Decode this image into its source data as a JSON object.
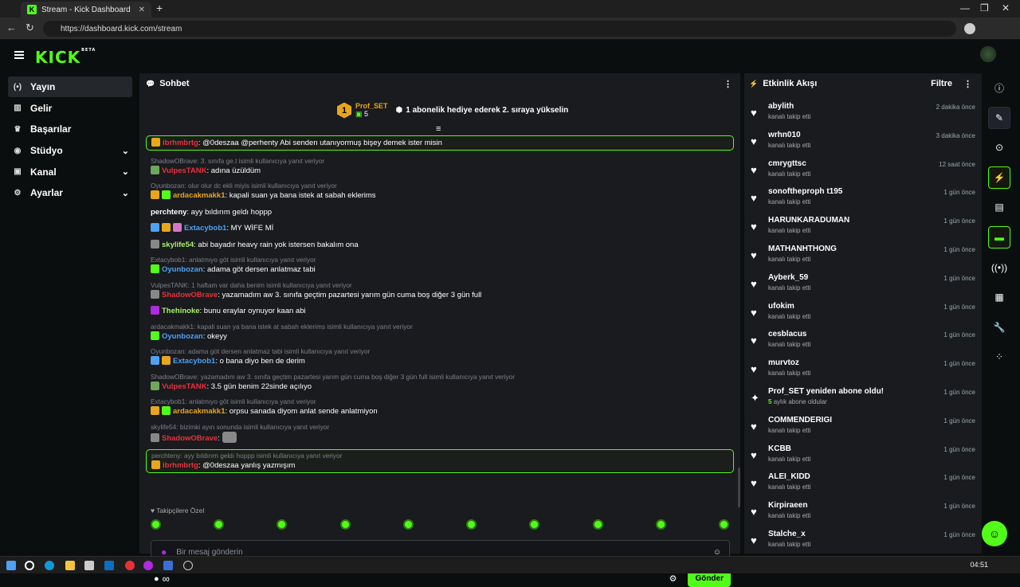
{
  "browser": {
    "tab_title": "Stream - Kick Dashboard",
    "url": "https://dashboard.kick.com/stream"
  },
  "header": {
    "logo": "KICK",
    "logo_badge": "BETA"
  },
  "sidebar": {
    "items": [
      {
        "label": "Yayın",
        "icon": "broadcast-icon",
        "active": true
      },
      {
        "label": "Gelir",
        "icon": "revenue-icon"
      },
      {
        "label": "Başarılar",
        "icon": "trophy-icon"
      },
      {
        "label": "Stüdyo",
        "icon": "studio-icon",
        "expandable": true
      },
      {
        "label": "Kanal",
        "icon": "channel-icon",
        "expandable": true
      },
      {
        "label": "Ayarlar",
        "icon": "settings-icon",
        "expandable": true
      }
    ]
  },
  "chat": {
    "title": "Sohbet",
    "pinned": {
      "rank": "1",
      "user": "Prof_SET",
      "gifts": "5",
      "text": "1 abonelik hediye ederek 2. sıraya yükselin"
    },
    "messages": [
      {
        "user": "ibrhmbrtg",
        "color": "#e8313d",
        "text": ": @0deszaa @perhenty Abi senden utanıyormuş bişey demek ister misin",
        "highlight": true,
        "badges": [
          "#e9a61b"
        ]
      },
      {
        "reply": "ShadowOBrave: 3. sınıfa ge.t isimli kullanıcıya yanıt veriyor",
        "user": "VulpesTANK",
        "color": "#e8313d",
        "text": ": adına üzüldüm",
        "badges": [
          "#6ea85f"
        ]
      },
      {
        "reply": "Oyunbozan: olur olur dc ekli miyis isimli kullanıcıya yanıt veriyor",
        "user": "ardacakmakk1",
        "color": "#e9a61b",
        "text": ": kapali suan ya bana istek at sabah eklerims",
        "badges": [
          "#e9a61b",
          "#53fc18"
        ]
      },
      {
        "user": "perchteny",
        "color": "#ffffff",
        "text": ": ayy bıldırım geldı hoppp",
        "badges": []
      },
      {
        "user": "Extacybob1",
        "color": "#4ea1f3",
        "text": ": MY WİFE Mİ",
        "badges": [
          "#4ea1f3",
          "#e9a61b",
          "#d577c9"
        ]
      },
      {
        "user": "skylife54",
        "color": "#a7f06a",
        "text": ": abi bayadır heavy rain yok istersen bakalım ona",
        "badges": [
          "#888888"
        ]
      },
      {
        "reply": "Extacybob1: anlatmıyo göt isimli kullanıcıya yanıt veriyor",
        "user": "Oyunbozan",
        "color": "#4ea1f3",
        "text": ": adama göt dersen anlatmaz tabi",
        "badges": [
          "#53fc18"
        ]
      },
      {
        "reply": "VulpesTANK: 1 haftam var daha benim isimli kullanıcıya yanıt veriyor",
        "user": "ShadowOBrave",
        "color": "#e8313d",
        "text": ": yazamadım aw 3. sınıfa geçtim pazartesi yarım gün cuma boş diğer 3 gün full",
        "badges": [
          "#888888"
        ]
      },
      {
        "user": "Thehinoke",
        "color": "#a7f06a",
        "text": ": bunu eraylar oynuyor kaan abi",
        "badges": [
          "#b02ae0"
        ]
      },
      {
        "reply": "ardacakmakk1: kapali suan ya bana istek at sabah eklerims isimli kullanıcıya yanıt veriyor",
        "user": "Oyunbozan",
        "color": "#4ea1f3",
        "text": ": okeyy",
        "badges": [
          "#53fc18"
        ]
      },
      {
        "reply": "Oyunbozan: adama göt dersen anlatmaz tabi isimli kullanıcıya yanıt veriyor",
        "user": "Extacybob1",
        "color": "#4ea1f3",
        "text": ": o bana diyo ben de derim",
        "badges": [
          "#4ea1f3",
          "#e9a61b"
        ]
      },
      {
        "reply": "ShadowOBrave: yazamadım aw 3. sınıfa geçtim pazartesi yarım gün cuma boş diğer 3 gün full isimli kullanıcıya yanıt veriyor",
        "user": "VulpesTANK",
        "color": "#e8313d",
        "text": ": 3.5 gün benim 22sinde açılıyo",
        "badges": [
          "#6ea85f"
        ]
      },
      {
        "reply": "Extacybob1: anlatmıyo göt isimli kullanıcıya yanıt veriyor",
        "user": "ardacakmakk1",
        "color": "#e9a61b",
        "text": ": orpsu sanada diyom anlat sende anlatmiyon",
        "badges": [
          "#e9a61b",
          "#53fc18"
        ]
      },
      {
        "reply": "skylife54: bizimki ayın sonunda isimli kullanıcıya yanıt veriyor",
        "user": "ShadowOBrave",
        "color": "#e8313d",
        "text": ":",
        "badges": [
          "#888888"
        ],
        "emote": true
      },
      {
        "reply": "perchteny: ayy bıldırım geldı hoppp isimli kullanıcıya yanıt veriyor",
        "user": "ibrhmbrtg",
        "color": "#e8313d",
        "text": ": @0deszaa yanlış yazmışım",
        "highlight": true,
        "badges": [
          "#e9a61b"
        ]
      }
    ],
    "followers_label": "Takipçilere Özel",
    "input_placeholder": "Bir mesaj gönderin",
    "infinity": "∞",
    "send_label": "Gönder"
  },
  "events": {
    "title": "Etkinlik Akışı",
    "filter_label": "Filtre",
    "items": [
      {
        "name": "abylith",
        "action": "kanalı takip etti",
        "time": "2 dakika önce"
      },
      {
        "name": "wrhn010",
        "action": "kanalı takip etti",
        "time": "3 dakika önce"
      },
      {
        "name": "cmrygttsc",
        "action": "kanalı takip etti",
        "time": "12 saat önce"
      },
      {
        "name": "sonoftheproph t195",
        "action": "kanalı takip etti",
        "time": "1 gün önce"
      },
      {
        "name": "HARUNKARADUMAN",
        "action": "kanalı takip etti",
        "time": "1 gün önce"
      },
      {
        "name": "MATHANHTHONG",
        "action": "kanalı takip etti",
        "time": "1 gün önce"
      },
      {
        "name": "Ayberk_59",
        "action": "kanalı takip etti",
        "time": "1 gün önce"
      },
      {
        "name": "ufokim",
        "action": "kanalı takip etti",
        "time": "1 gün önce"
      },
      {
        "name": "cesblacus",
        "action": "kanalı takip etti",
        "time": "1 gün önce"
      },
      {
        "name": "murvtoz",
        "action": "kanalı takip etti",
        "time": "1 gün önce"
      },
      {
        "name": "Prof_SET yeniden abone oldu!",
        "action": "aylık abone oldular",
        "action_num": "5",
        "time": "1 gün önce",
        "sub": true
      },
      {
        "name": "COMMENDERIGI",
        "action": "kanalı takip etti",
        "time": "1 gün önce"
      },
      {
        "name": "KCBB",
        "action": "kanalı takip etti",
        "time": "1 gün önce"
      },
      {
        "name": "ALEI_KIDD",
        "action": "kanalı takip etti",
        "time": "1 gün önce"
      },
      {
        "name": "Kirpiraeen",
        "action": "kanalı takip etti",
        "time": "1 gün önce"
      },
      {
        "name": "Stalche_x",
        "action": "kanalı takip etti",
        "time": "1 gün önce"
      }
    ]
  },
  "taskbar": {
    "time": "04:51"
  }
}
